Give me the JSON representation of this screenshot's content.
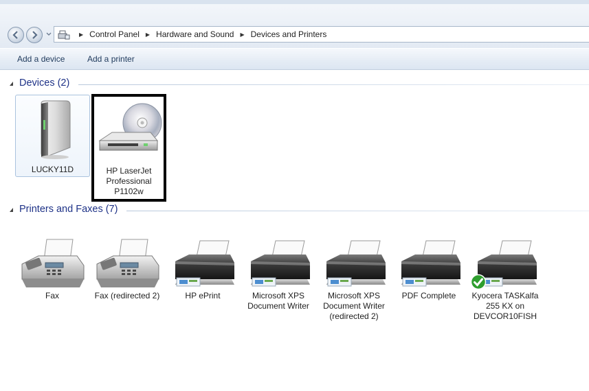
{
  "address_bar": {
    "breadcrumbs": [
      "Control Panel",
      "Hardware and Sound",
      "Devices and Printers"
    ]
  },
  "command_bar": {
    "add_device": "Add a device",
    "add_printer": "Add a printer"
  },
  "groups": {
    "devices": {
      "title": "Devices (2)"
    },
    "printers": {
      "title": "Printers and Faxes (7)"
    }
  },
  "devices": [
    {
      "label": "LUCKY11D",
      "icon": "computer-tower-icon"
    },
    {
      "label": "HP LaserJet\nProfessional\nP1102w",
      "icon": "disc-drive-icon"
    }
  ],
  "printers": [
    {
      "label": "Fax",
      "icon": "fax-icon"
    },
    {
      "label": "Fax (redirected 2)",
      "icon": "fax-icon"
    },
    {
      "label": "HP ePrint",
      "icon": "printer-icon"
    },
    {
      "label": "Microsoft XPS\nDocument Writer",
      "icon": "printer-icon"
    },
    {
      "label": "Microsoft XPS\nDocument Writer\n(redirected 2)",
      "icon": "printer-icon"
    },
    {
      "label": "PDF Complete",
      "icon": "printer-icon"
    },
    {
      "label": "Kyocera TASKalfa\n255 KX on\nDEVCOR10FISH",
      "icon": "printer-icon",
      "status": "default-check-icon"
    }
  ],
  "colors": {
    "group_title": "#1e3287",
    "command_text": "#1e395b"
  }
}
